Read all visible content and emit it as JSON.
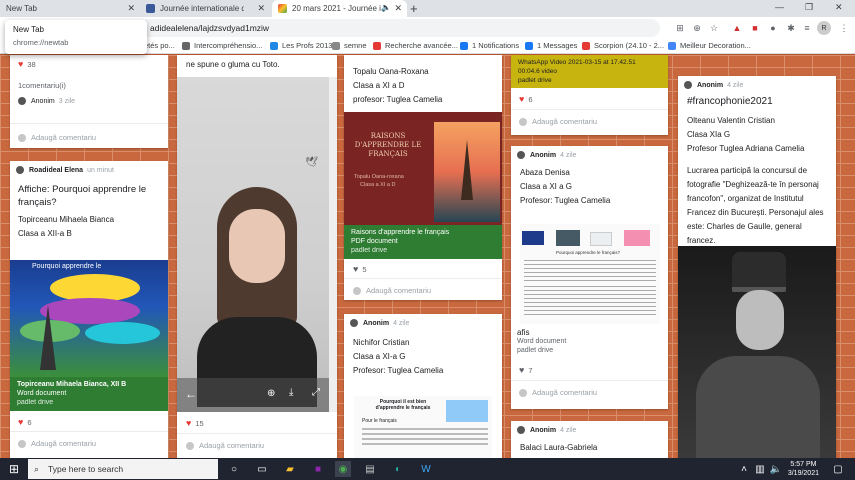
{
  "browser": {
    "tabs": [
      {
        "title": "New Tab",
        "active": false
      },
      {
        "title": "Journée internationale de la Fran",
        "active": false
      },
      {
        "title": "20 mars 2021 - Journée intern",
        "active": true
      }
    ],
    "new_tab": "+",
    "url": "adidealelena/lajdzsvdyad1mziw",
    "popup_title": "New Tab",
    "popup_url": "chrome://newtab",
    "bookmarks": [
      "etés po...",
      "Intercompréhensio...",
      "Les Profs 2013",
      "semne",
      "Recherche avancée...",
      "1 Notifications",
      "1 Messages",
      "Scorpion (24.10 - 2...",
      "Meilleur Decoration..."
    ]
  },
  "col1": {
    "card1": {
      "likes": "38",
      "comments": "1comentariu(i)",
      "author": "Anonim",
      "time": "3 zile",
      "add_comment": "Adaugă comentariu"
    },
    "card2": {
      "author": "Roadideal Elena",
      "time": "un minut",
      "title": "Affiche: Pourquoi apprendre le français?",
      "line1": "Topirceanu Mihaela Bianca",
      "line2": "Clasa a XII-a B",
      "image_caption": "Pourquoi apprendre le",
      "att_title": "Topirceanu Mihaela Bianca, XII B",
      "att_type": "Word document",
      "att_src": "padlet drive",
      "likes": "6",
      "add_comment": "Adaugă comentariu"
    }
  },
  "col2": {
    "caption": "ne spune o gluma cu Toto.",
    "likes": "15",
    "add_comment": "Adaugă comentariu"
  },
  "col3": {
    "card1": {
      "line1": "Topalu Oana-Roxana",
      "line2": "Clasa a XI a D",
      "line3": "profesor: Tuglea Camelia",
      "pdf_title": "RAISONS D'APPRENDRE LE FRANÇAIS",
      "pdf_sub": "Topalu Oana-roxana",
      "pdf_sub2": "Clasa a XI a D",
      "att_title": "Raisons d'apprendre le français",
      "att_type": "PDF document",
      "att_src": "padlet drive",
      "likes": "5",
      "add_comment": "Adaugă comentariu"
    },
    "card2": {
      "author": "Anonim",
      "time": "4 zile",
      "line1": "Nichifor Cristian",
      "line2": "Clasa a XI-a G",
      "line3": "Profesor:  Tuglea Camelia",
      "doc_title": "Pourquoi il est bien d'apprendre le français",
      "doc_sub": "Pour le français"
    }
  },
  "col4": {
    "card1": {
      "att_title": "WhatsApp Video 2021-03-15 at 17.42.51",
      "att_sub": "00:04.6 video",
      "att_src": "padlet drive",
      "likes": "6",
      "add_comment": "Adaugă comentariu"
    },
    "card2": {
      "author": "Anonim",
      "time": "4 zile",
      "line1": "Abaza Denisa",
      "line2": "Clasa a XI a G",
      "line3": "Profesor: Tuglea Camelia",
      "doc_heading": "Pourquoi apprendre le français?",
      "att_title": "afis",
      "att_type": "Word document",
      "att_src": "padlet drive",
      "likes": "7",
      "add_comment": "Adaugă comentariu"
    },
    "card3": {
      "author": "Anonim",
      "time": "4 zile",
      "line1": "Balaci Laura-Gabriela"
    }
  },
  "col5": {
    "card1": {
      "author": "Anonim",
      "time": "4 zile",
      "title": "#francophonie2021",
      "line1": "Olteanu Valentin Cristian",
      "line2": "Clasa XIa G",
      "line3": "Profesor Tuglea Adriana Camelia",
      "para": "Lucrarea participă la concursul de fotografie \"Deghizează-te în personaj francofon\", organizat de Institutul Francez din București. Personajul ales este: Charles de Gaulle, general francez."
    }
  },
  "fab": "+",
  "taskbar": {
    "search_placeholder": "Type here to search",
    "time": "5:57 PM",
    "date": "3/19/2021"
  },
  "colors": {
    "brick": "#c9683e",
    "green_bar": "#2e7d32",
    "yellow_bar": "#c7b40e",
    "fab": "#e91e63",
    "pdf_bg": "#7a2424"
  }
}
